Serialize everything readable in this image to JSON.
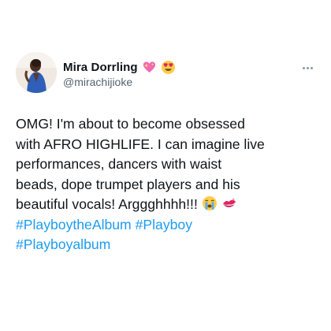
{
  "author": {
    "display_name": "Mira Dorrling",
    "handle": "@mirachijioke",
    "name_emojis": [
      "sparkling-heart-emoji",
      "heart-eyes-emoji"
    ]
  },
  "tweet": {
    "lines": [
      "OMG! I'm about to become obsessed",
      "with AFRO HIGHLIFE. I can imagine live",
      "performances, dancers with waist",
      "beads, dope trumpet players and his",
      "beautiful vocals! Arggghhhh!!!"
    ],
    "hashtags": [
      "#PlayboytheAlbum",
      "#Playboy",
      "#Playboyalbum"
    ],
    "emojis": [
      "loudly-crying-emoji",
      "kiss-mark-emoji"
    ]
  },
  "colors": {
    "link": "#1d9bf0",
    "text": "#0f1419",
    "secondary": "#536471"
  }
}
